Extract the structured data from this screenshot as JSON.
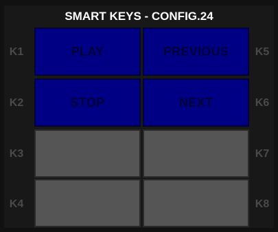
{
  "title": "SMART KEYS - CONFIG.24",
  "colors": {
    "background": "#111111",
    "panel": "#181818",
    "assigned_key": "#000084",
    "assigned_key_text": "#00003a",
    "empty_key": "#555555",
    "key_label": "#4a4a4a",
    "title_text": "#ffffff"
  },
  "left_labels": [
    "K1",
    "K2",
    "K3",
    "K4"
  ],
  "right_labels": [
    "K5",
    "K6",
    "K7",
    "K8"
  ],
  "keys": [
    {
      "id": "K1",
      "label": "PLAY"
    },
    {
      "id": "K2",
      "label": "STOP"
    },
    {
      "id": "K3",
      "label": ""
    },
    {
      "id": "K4",
      "label": ""
    },
    {
      "id": "K5",
      "label": "PREVIOUS"
    },
    {
      "id": "K6",
      "label": "NEXT"
    },
    {
      "id": "K7",
      "label": ""
    },
    {
      "id": "K8",
      "label": ""
    }
  ]
}
